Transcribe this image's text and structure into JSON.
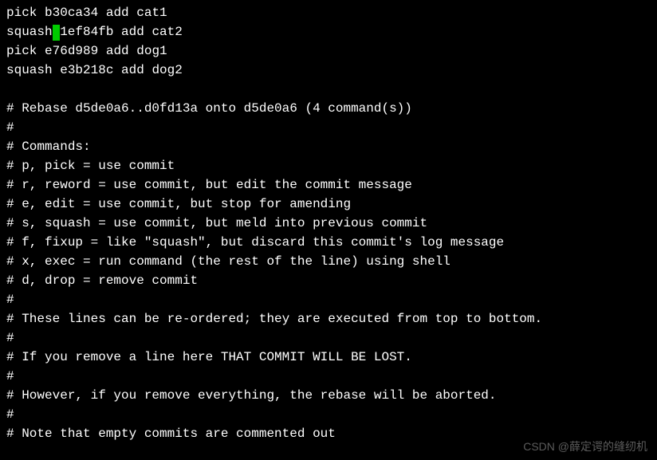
{
  "commits": [
    {
      "action": "pick",
      "hash": "b30ca34",
      "message": "add cat1"
    },
    {
      "action": "squash",
      "hash": "1ef84fb",
      "message": "add cat2",
      "cursorAfterAction": true
    },
    {
      "action": "pick",
      "hash": "e76d989",
      "message": "add dog1"
    },
    {
      "action": "squash",
      "hash": "e3b218c",
      "message": "add dog2"
    }
  ],
  "comments": [
    "",
    "# Rebase d5de0a6..d0fd13a onto d5de0a6 (4 command(s))",
    "#",
    "# Commands:",
    "# p, pick = use commit",
    "# r, reword = use commit, but edit the commit message",
    "# e, edit = use commit, but stop for amending",
    "# s, squash = use commit, but meld into previous commit",
    "# f, fixup = like \"squash\", but discard this commit's log message",
    "# x, exec = run command (the rest of the line) using shell",
    "# d, drop = remove commit",
    "#",
    "# These lines can be re-ordered; they are executed from top to bottom.",
    "#",
    "# If you remove a line here THAT COMMIT WILL BE LOST.",
    "#",
    "# However, if you remove everything, the rebase will be aborted.",
    "#",
    "# Note that empty commits are commented out"
  ],
  "watermark": "CSDN @薛定谔的缝纫机"
}
